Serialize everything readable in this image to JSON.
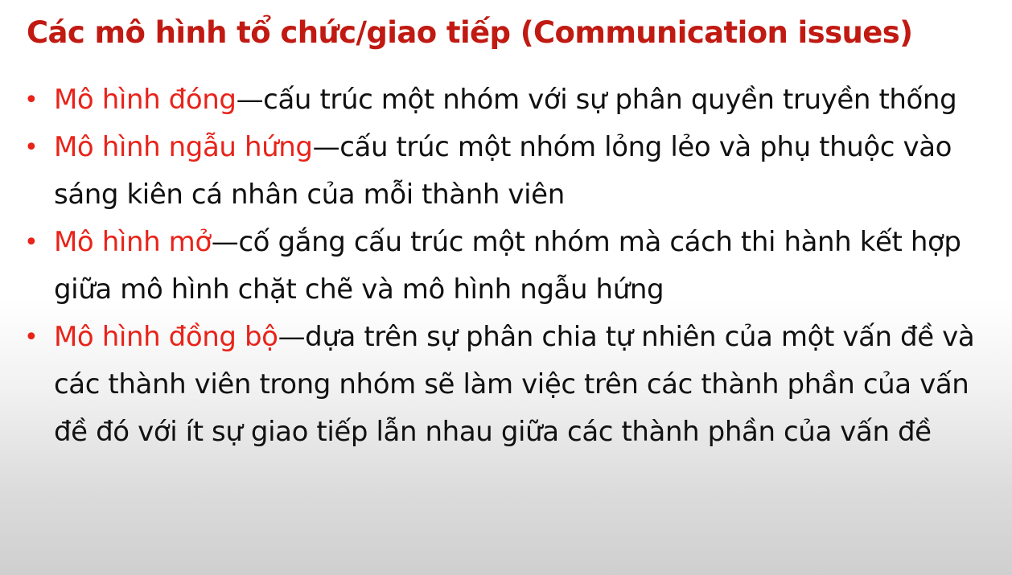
{
  "colors": {
    "accent": "#e8231a",
    "title": "#c01a12",
    "text": "#111111"
  },
  "slide": {
    "title": "Các mô hình tổ chức/giao tiếp (Communication issues)",
    "bullet_symbol": "•",
    "items": [
      {
        "term": "Mô hình đóng",
        "description": "—cấu trúc một nhóm với sự phân quyền truyền thống"
      },
      {
        "term": "Mô hình ngẫu hứng",
        "description": "—cấu trúc một nhóm lỏng lẻo và phụ thuộc vào sáng kiên cá nhân của mỗi thành viên"
      },
      {
        "term": "Mô hình mở",
        "description": "—cố gắng cấu trúc một nhóm mà cách thi hành kết hợp giữa mô hình chặt chẽ và mô hình ngẫu hứng"
      },
      {
        "term": "Mô hình đồng bộ",
        "description": "—dựa trên sự phân chia tự nhiên của một vấn đề và các thành viên trong nhóm sẽ làm việc trên các thành phần của vấn đề đó với ít sự giao tiếp lẫn nhau giữa các thành phần của vấn đề"
      }
    ]
  }
}
